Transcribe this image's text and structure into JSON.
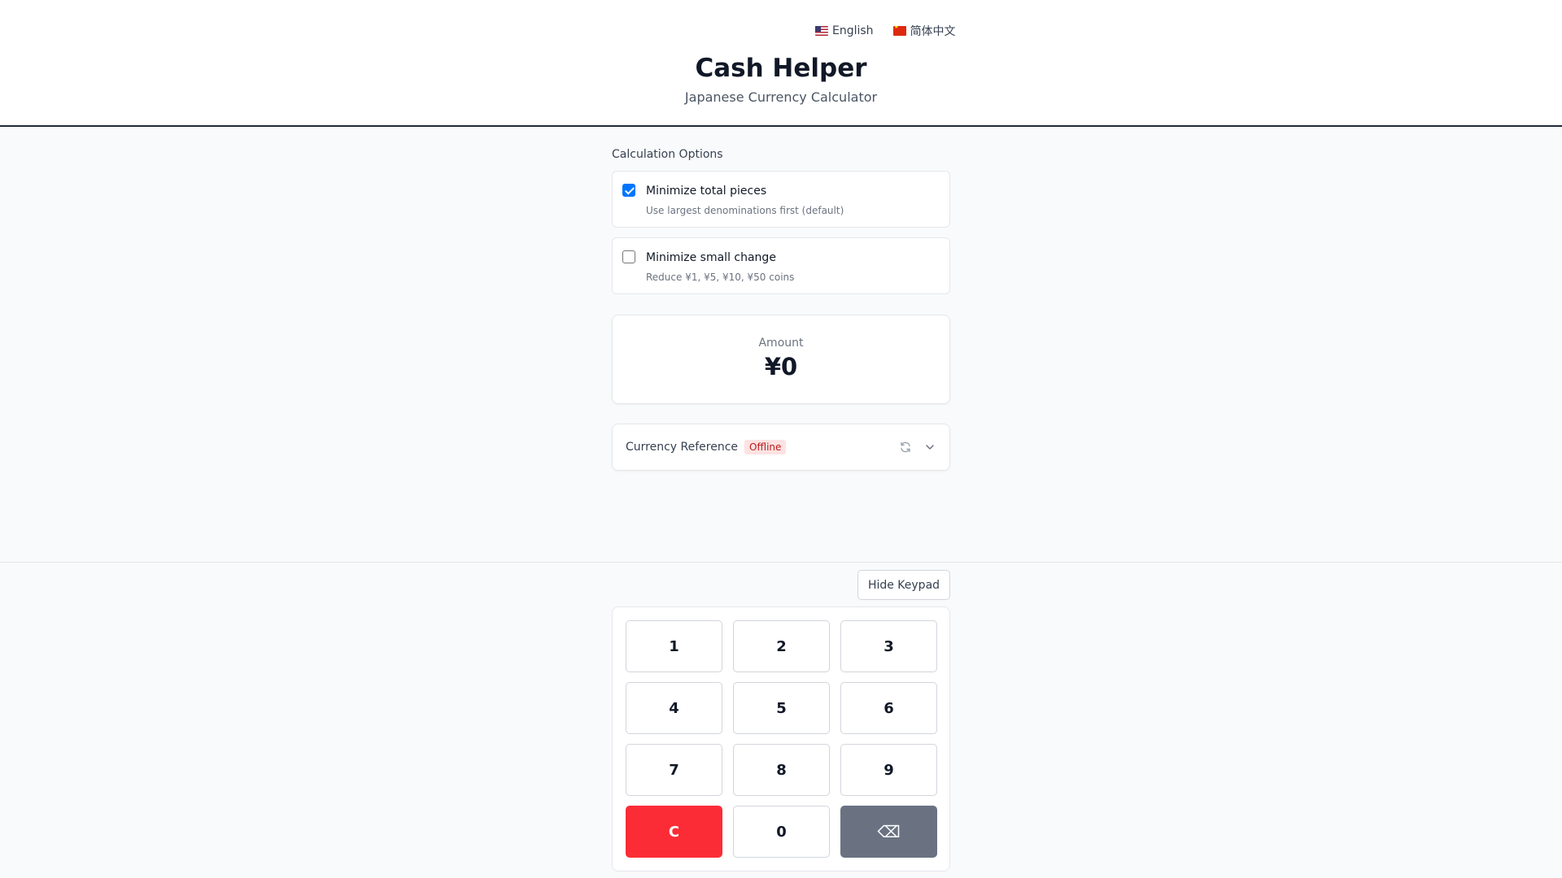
{
  "languages": [
    {
      "label": "English",
      "flag": "us-flag"
    },
    {
      "label": "简体中文",
      "flag": "cn-flag"
    }
  ],
  "header": {
    "title": "Cash Helper",
    "subtitle": "Japanese Currency Calculator"
  },
  "options": {
    "section_label": "Calculation Options",
    "items": [
      {
        "title": "Minimize total pieces",
        "description": "Use largest denominations first (default)",
        "checked": true
      },
      {
        "title": "Minimize small change",
        "description": "Reduce ¥1, ¥5, ¥10, ¥50 coins",
        "checked": false
      }
    ]
  },
  "amount": {
    "label": "Amount",
    "value": "¥0"
  },
  "currency_reference": {
    "title": "Currency Reference",
    "status": "Offline",
    "icons": [
      "refresh-icon",
      "chevron-down-icon"
    ]
  },
  "keypad": {
    "hide_label": "Hide Keypad",
    "keys": [
      "1",
      "2",
      "3",
      "4",
      "5",
      "6",
      "7",
      "8",
      "9",
      "C",
      "0",
      "⌫"
    ]
  },
  "colors": {
    "clear_key": "#fb2c36",
    "backspace_key": "#6a7282",
    "checkbox_accent": "#0075ff",
    "offline_badge_bg": "#fee2e2",
    "offline_badge_text": "#b91c1c"
  }
}
